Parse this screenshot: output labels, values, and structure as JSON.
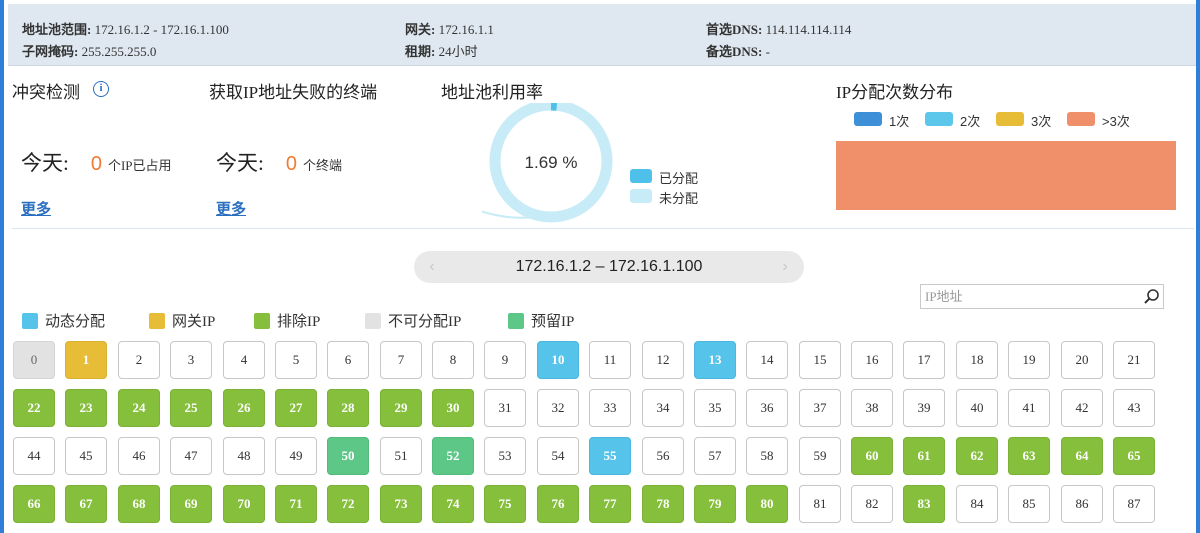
{
  "info_bar": {
    "pool_range_label": "地址池范围:",
    "pool_range_value": "172.16.1.2 - 172.16.1.100",
    "subnet_label": "子网掩码:",
    "subnet_value": "255.255.255.0",
    "gateway_label": "网关:",
    "gateway_value": "172.16.1.1",
    "lease_label": "租期:",
    "lease_value": "24小时",
    "dns1_label": "首选DNS:",
    "dns1_value": "114.114.114.114",
    "dns2_label": "备选DNS:",
    "dns2_value": "-"
  },
  "conflict": {
    "title": "冲突检测",
    "info_glyph": "i",
    "today_label": "今天:",
    "count": "0",
    "unit": "个IP已占用",
    "more": "更多"
  },
  "failed": {
    "title": "获取IP地址失败的终端",
    "today_label": "今天:",
    "count": "0",
    "unit": "个终端",
    "more": "更多"
  },
  "utilization": {
    "title": "地址池利用率",
    "percent_text": "1.69 %",
    "allocated_fraction": 0.0169,
    "allocated_color": "#4fc0ea",
    "unallocated_color": "#c7ebf7",
    "legend": [
      {
        "label": "已分配",
        "color": "#4fc0ea"
      },
      {
        "label": "未分配",
        "color": "#c7ebf7"
      }
    ]
  },
  "distribution": {
    "title": "IP分配次数分布",
    "legend": [
      {
        "label": "1次",
        "color": "#3d8fd8"
      },
      {
        "label": "2次",
        "color": "#5cc7ea"
      },
      {
        "label": "3次",
        "color": "#e7bd37"
      },
      {
        "label": ">3次",
        "color": "#f0906a"
      }
    ],
    "bar_color": "#f0906a"
  },
  "range_pill": {
    "text": "172.16.1.2 – 172.16.1.100",
    "prev_glyph": "‹",
    "next_glyph": "›"
  },
  "search": {
    "placeholder": "IP地址",
    "value": ""
  },
  "ip_legend": [
    {
      "label": "动态分配",
      "color": "#55c3ea"
    },
    {
      "label": "网关IP",
      "color": "#e7bd37"
    },
    {
      "label": "排除IP",
      "color": "#85bf3b"
    },
    {
      "label": "不可分配IP",
      "color": "#e2e2e2"
    },
    {
      "label": "预留IP",
      "color": "#5dc788"
    }
  ],
  "ip_cells": [
    {
      "n": "0",
      "s": "gray"
    },
    {
      "n": "1",
      "s": "yellow"
    },
    {
      "n": "2",
      "s": "white"
    },
    {
      "n": "3",
      "s": "white"
    },
    {
      "n": "4",
      "s": "white"
    },
    {
      "n": "5",
      "s": "white"
    },
    {
      "n": "6",
      "s": "white"
    },
    {
      "n": "7",
      "s": "white"
    },
    {
      "n": "8",
      "s": "white"
    },
    {
      "n": "9",
      "s": "white"
    },
    {
      "n": "10",
      "s": "blue"
    },
    {
      "n": "11",
      "s": "white"
    },
    {
      "n": "12",
      "s": "white"
    },
    {
      "n": "13",
      "s": "blue"
    },
    {
      "n": "14",
      "s": "white"
    },
    {
      "n": "15",
      "s": "white"
    },
    {
      "n": "16",
      "s": "white"
    },
    {
      "n": "17",
      "s": "white"
    },
    {
      "n": "18",
      "s": "white"
    },
    {
      "n": "19",
      "s": "white"
    },
    {
      "n": "20",
      "s": "white"
    },
    {
      "n": "21",
      "s": "white"
    },
    {
      "n": "22",
      "s": "green"
    },
    {
      "n": "23",
      "s": "green"
    },
    {
      "n": "24",
      "s": "green"
    },
    {
      "n": "25",
      "s": "green"
    },
    {
      "n": "26",
      "s": "green"
    },
    {
      "n": "27",
      "s": "green"
    },
    {
      "n": "28",
      "s": "green"
    },
    {
      "n": "29",
      "s": "green"
    },
    {
      "n": "30",
      "s": "green"
    },
    {
      "n": "31",
      "s": "white"
    },
    {
      "n": "32",
      "s": "white"
    },
    {
      "n": "33",
      "s": "white"
    },
    {
      "n": "34",
      "s": "white"
    },
    {
      "n": "35",
      "s": "white"
    },
    {
      "n": "36",
      "s": "white"
    },
    {
      "n": "37",
      "s": "white"
    },
    {
      "n": "38",
      "s": "white"
    },
    {
      "n": "39",
      "s": "white"
    },
    {
      "n": "40",
      "s": "white"
    },
    {
      "n": "41",
      "s": "white"
    },
    {
      "n": "42",
      "s": "white"
    },
    {
      "n": "43",
      "s": "white"
    },
    {
      "n": "44",
      "s": "white"
    },
    {
      "n": "45",
      "s": "white"
    },
    {
      "n": "46",
      "s": "white"
    },
    {
      "n": "47",
      "s": "white"
    },
    {
      "n": "48",
      "s": "white"
    },
    {
      "n": "49",
      "s": "white"
    },
    {
      "n": "50",
      "s": "teal"
    },
    {
      "n": "51",
      "s": "white"
    },
    {
      "n": "52",
      "s": "teal"
    },
    {
      "n": "53",
      "s": "white"
    },
    {
      "n": "54",
      "s": "white"
    },
    {
      "n": "55",
      "s": "blue"
    },
    {
      "n": "56",
      "s": "white"
    },
    {
      "n": "57",
      "s": "white"
    },
    {
      "n": "58",
      "s": "white"
    },
    {
      "n": "59",
      "s": "white"
    },
    {
      "n": "60",
      "s": "green"
    },
    {
      "n": "61",
      "s": "green"
    },
    {
      "n": "62",
      "s": "green"
    },
    {
      "n": "63",
      "s": "green"
    },
    {
      "n": "64",
      "s": "green"
    },
    {
      "n": "65",
      "s": "green"
    },
    {
      "n": "66",
      "s": "green"
    },
    {
      "n": "67",
      "s": "green"
    },
    {
      "n": "68",
      "s": "green"
    },
    {
      "n": "69",
      "s": "green"
    },
    {
      "n": "70",
      "s": "green"
    },
    {
      "n": "71",
      "s": "green"
    },
    {
      "n": "72",
      "s": "green"
    },
    {
      "n": "73",
      "s": "green"
    },
    {
      "n": "74",
      "s": "green"
    },
    {
      "n": "75",
      "s": "green"
    },
    {
      "n": "76",
      "s": "green"
    },
    {
      "n": "77",
      "s": "green"
    },
    {
      "n": "78",
      "s": "green"
    },
    {
      "n": "79",
      "s": "green"
    },
    {
      "n": "80",
      "s": "green"
    },
    {
      "n": "81",
      "s": "white"
    },
    {
      "n": "82",
      "s": "white"
    },
    {
      "n": "83",
      "s": "green"
    },
    {
      "n": "84",
      "s": "white"
    },
    {
      "n": "85",
      "s": "white"
    },
    {
      "n": "86",
      "s": "white"
    },
    {
      "n": "87",
      "s": "white"
    }
  ]
}
